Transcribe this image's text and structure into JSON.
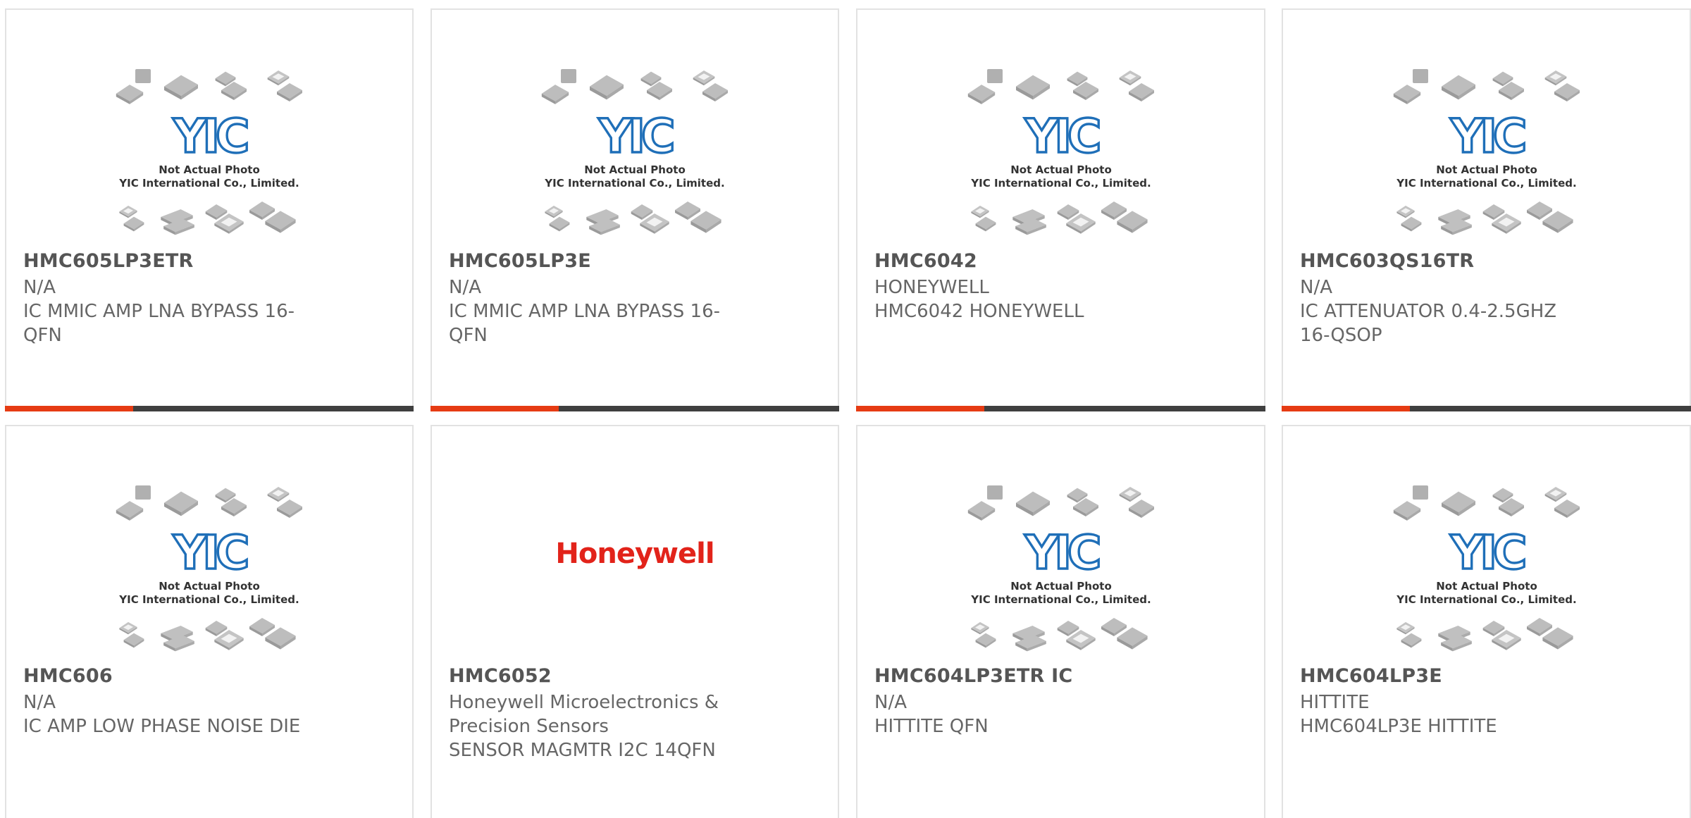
{
  "placeholder": {
    "line1": "Not Actual Photo",
    "line2": "YIC International Co., Limited.",
    "logo_text": "YIC"
  },
  "products": [
    {
      "part": "HMC605LP3ETR",
      "maker": "N/A",
      "desc": "IC MMIC AMP LNA BYPASS 16-QFN",
      "image": "yic-placeholder"
    },
    {
      "part": "HMC605LP3E",
      "maker": "N/A",
      "desc": "IC MMIC AMP LNA BYPASS 16-QFN",
      "image": "yic-placeholder"
    },
    {
      "part": "HMC6042",
      "maker": "HONEYWELL",
      "desc": "HMC6042 HONEYWELL",
      "image": "yic-placeholder"
    },
    {
      "part": "HMC603QS16TR",
      "maker": "N/A",
      "desc": "IC ATTENUATOR 0.4-2.5GHZ 16-QSOP",
      "image": "yic-placeholder"
    },
    {
      "part": "HMC606",
      "maker": "N/A",
      "desc": "IC AMP LOW PHASE NOISE DIE",
      "image": "yic-placeholder"
    },
    {
      "part": "HMC6052",
      "maker": "Honeywell Microelectronics & Precision Sensors",
      "desc": "SENSOR MAGMTR I2C 14QFN",
      "image": "honeywell-logo",
      "logo_text": "Honeywell"
    },
    {
      "part": "HMC604LP3ETR IC",
      "maker": "N/A",
      "desc": "HITTITE QFN",
      "image": "yic-placeholder"
    },
    {
      "part": "HMC604LP3E",
      "maker": "HITTITE",
      "desc": "HMC604LP3E HITTITE",
      "image": "yic-placeholder"
    }
  ],
  "colors": {
    "accent": "#e63b13",
    "bar": "#3f3f3f",
    "logo_blue": "#1f6fb8",
    "honeywell_red": "#e2231a"
  }
}
